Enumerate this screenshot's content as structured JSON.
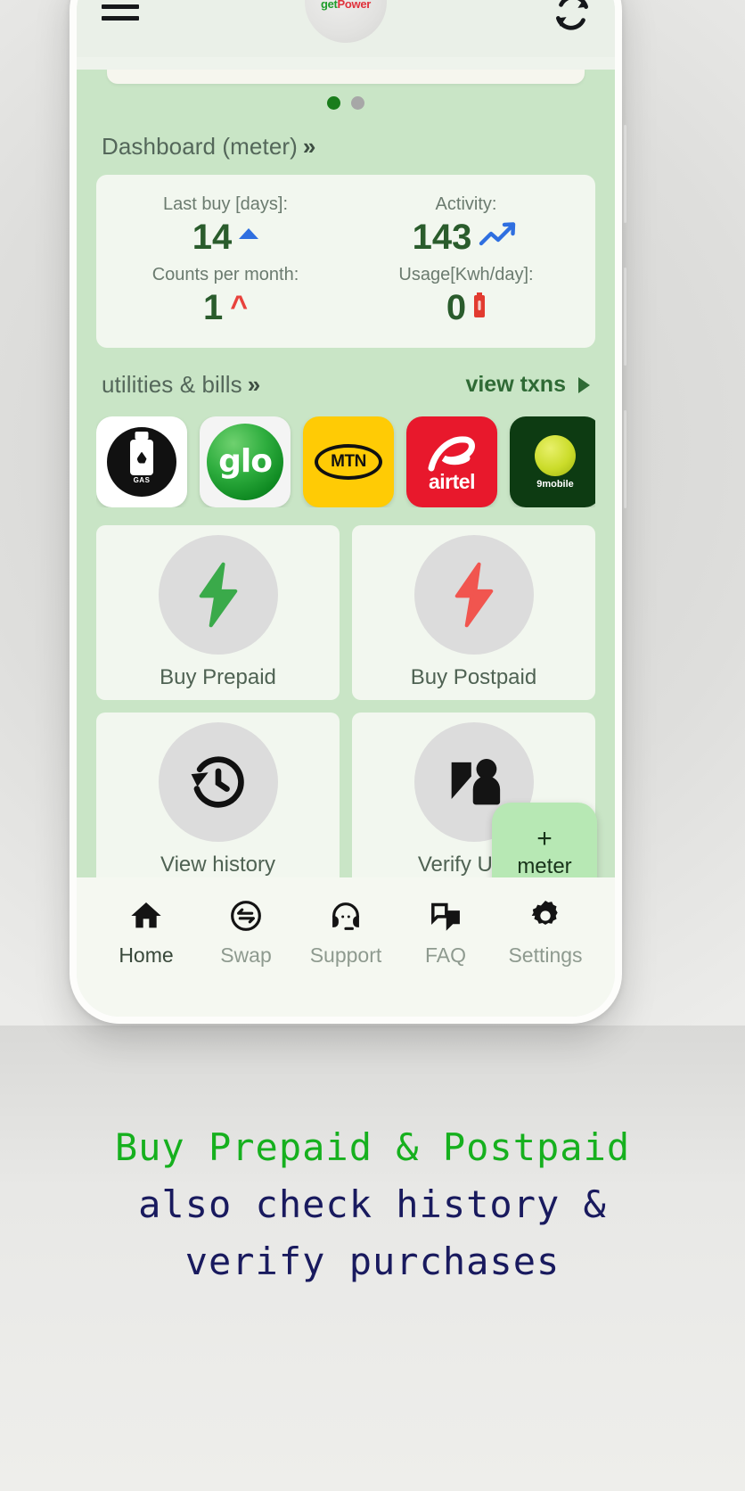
{
  "app": {
    "logo_get": "get",
    "logo_power": "Power",
    "menu_icon": "hamburger-menu-icon",
    "refresh_icon": "refresh-icon"
  },
  "carousel": {
    "dots": [
      {
        "state": "active"
      },
      {
        "state": "inactive"
      }
    ]
  },
  "dashboard": {
    "title": "Dashboard (meter)",
    "chevron": "»",
    "stats": [
      {
        "label": "Last buy [days]:",
        "value": "14",
        "indicator": "triangle-up-blue"
      },
      {
        "label": "Activity:",
        "value": "143",
        "indicator": "trend-up-blue"
      },
      {
        "label": "Counts per month:",
        "value": "1",
        "indicator": "caret-up-red"
      },
      {
        "label": "Usage[Kwh/day]:",
        "value": "0",
        "indicator": "battery-red"
      }
    ]
  },
  "utilities": {
    "title": "utilities & bills",
    "chevron": "»",
    "view_txns": "view txns",
    "logos": [
      {
        "name": "gas",
        "label": "GAS"
      },
      {
        "name": "glo",
        "label": "glo"
      },
      {
        "name": "mtn",
        "label": "MTN"
      },
      {
        "name": "airtel",
        "label": "airtel"
      },
      {
        "name": "9mobile",
        "label": "9mobile"
      }
    ]
  },
  "actions": [
    {
      "label": "Buy Prepaid",
      "icon": "bolt-green-icon"
    },
    {
      "label": "Buy Postpaid",
      "icon": "bolt-red-icon"
    },
    {
      "label": "View history",
      "icon": "history-clock-icon"
    },
    {
      "label": "Verify Utility",
      "icon": "verify-person-icon"
    }
  ],
  "fab": {
    "plus": "+",
    "label": "meter"
  },
  "bottom_nav": [
    {
      "label": "Home",
      "icon": "home-icon",
      "active": true
    },
    {
      "label": "Swap",
      "icon": "swap-icon",
      "active": false
    },
    {
      "label": "Support",
      "icon": "headset-icon",
      "active": false
    },
    {
      "label": "FAQ",
      "icon": "chat-icon",
      "active": false
    },
    {
      "label": "Settings",
      "icon": "gear-icon",
      "active": false
    }
  ],
  "caption": {
    "line1": "Buy Prepaid & Postpaid",
    "line2": "also check history &",
    "line3": "verify purchases"
  },
  "colors": {
    "accent_green": "#16b01e",
    "navy": "#191a5e",
    "app_green_bg": "#c9e5c6",
    "card_bg": "#f2f7ef",
    "bolt_green": "#3aaa4a",
    "bolt_red": "#f1554f"
  }
}
